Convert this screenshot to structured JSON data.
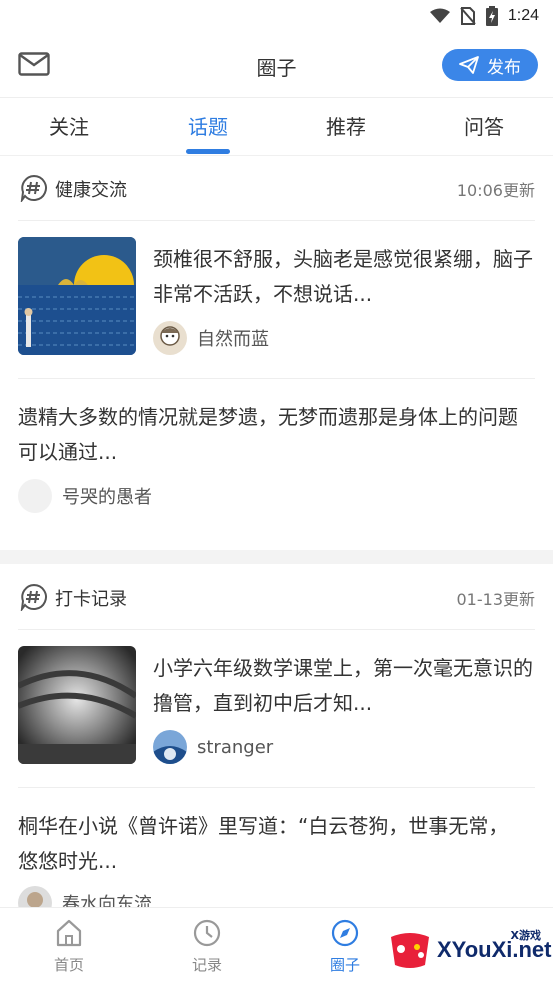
{
  "status": {
    "time": "1:24"
  },
  "header": {
    "title": "圈子",
    "publish_label": "发布"
  },
  "tabs": [
    {
      "label": "关注",
      "active": false
    },
    {
      "label": "话题",
      "active": true
    },
    {
      "label": "推荐",
      "active": false
    },
    {
      "label": "问答",
      "active": false
    }
  ],
  "sections": [
    {
      "name": "健康交流",
      "updated": "10:06更新",
      "featured": {
        "title": "颈椎很不舒服，头脑老是感觉很紧绷，脑子非常不活跃，不想说话...",
        "author": "自然而蓝"
      },
      "post": {
        "text": "遗精大多数的情况就是梦遗，无梦而遗那是身体上的问题可以通过...",
        "author": "号哭的愚者"
      }
    },
    {
      "name": "打卡记录",
      "updated": "01-13更新",
      "featured": {
        "title": "小学六年级数学课堂上，第一次毫无意识的撸管，直到初中后才知...",
        "author": "stranger"
      },
      "post": {
        "text": "桐华在小说《曾许诺》里写道：“白云苍狗，世事无常，悠悠时光...",
        "author": "春水向东流"
      }
    }
  ],
  "bottom_nav": [
    {
      "label": "首页",
      "icon": "home-icon",
      "active": false
    },
    {
      "label": "记录",
      "icon": "clock-icon",
      "active": false
    },
    {
      "label": "圈子",
      "icon": "compass-icon",
      "active": true
    }
  ],
  "watermark": {
    "brand": "XYouXi.net",
    "small": "X游戏"
  },
  "colors": {
    "accent": "#2f7de1",
    "publish_bg": "#3b86e8"
  }
}
